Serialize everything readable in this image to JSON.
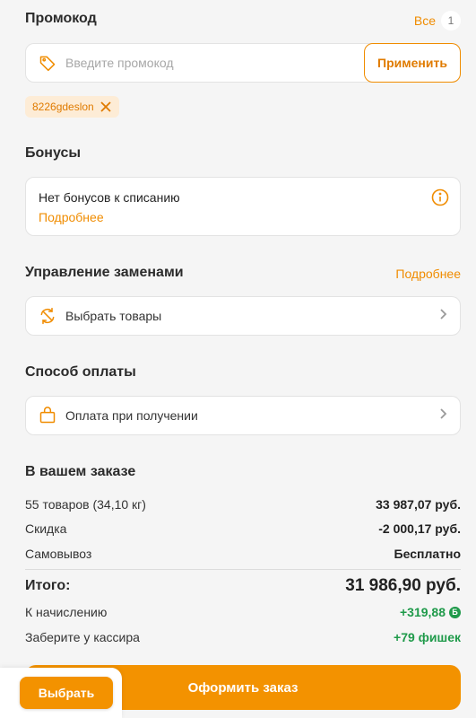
{
  "promo": {
    "title": "Промокод",
    "all_label": "Все",
    "count": "1",
    "placeholder": "Введите промокод",
    "apply_label": "Применить",
    "applied_code": "8226gdeslon"
  },
  "bonuses": {
    "title": "Бонусы",
    "message": "Нет бонусов к списанию",
    "more_label": "Подробнее"
  },
  "replacements": {
    "title": "Управление заменами",
    "more_label": "Подробнее",
    "select_label": "Выбрать товары"
  },
  "payment": {
    "title": "Способ оплаты",
    "method": "Оплата при получении"
  },
  "summary": {
    "title": "В вашем заказе",
    "rows": [
      {
        "label": "55 товаров (34,10 кг)",
        "value": "33 987,07 руб."
      },
      {
        "label": "Скидка",
        "value": "-2 000,17 руб."
      },
      {
        "label": "Самовывоз",
        "value": "Бесплатно"
      }
    ],
    "total_label": "Итого:",
    "total_value": "31 986,90 руб.",
    "accrual_label": "К начислению",
    "accrual_value": "+319,88",
    "cashier_label": "Заберите у кассира",
    "cashier_value": "+79 фишек"
  },
  "actions": {
    "order_label": "Оформить заказ",
    "choose_label": "Выбрать"
  },
  "colors": {
    "accent": "#f39200",
    "accent_text": "#f08c00",
    "green": "#1f9a4a"
  }
}
